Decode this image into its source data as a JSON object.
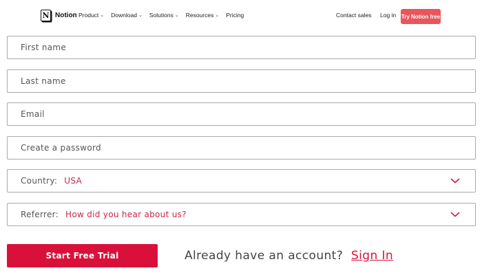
{
  "nav": {
    "brand": "Notion",
    "logo_letter": "N",
    "links": [
      {
        "label": "Product",
        "dropdown": true
      },
      {
        "label": "Download",
        "dropdown": true
      },
      {
        "label": "Solutions",
        "dropdown": true
      },
      {
        "label": "Resources",
        "dropdown": true
      },
      {
        "label": "Pricing",
        "dropdown": false
      }
    ],
    "contact_sales": "Contact sales",
    "log_in": "Log in",
    "try_button": "Try Notion free",
    "chevron_glyph": "⌄"
  },
  "form": {
    "first_name_placeholder": "First name",
    "last_name_placeholder": "Last name",
    "email_placeholder": "Email",
    "password_placeholder": "Create a password",
    "country_label": "Country:",
    "country_value": "USA",
    "referrer_label": "Referrer:",
    "referrer_value": "How did you hear about us?",
    "submit_label": "Start Free Trial",
    "already_text": "Already have an account?",
    "sign_in_label": "Sign In"
  },
  "colors": {
    "accent": "#d9113a",
    "nav_cta": "#e8565b",
    "border": "#a9a9a9"
  },
  "icons": {
    "logo": "notion-logo-icon",
    "select_chevron": "chevron-down-icon"
  }
}
